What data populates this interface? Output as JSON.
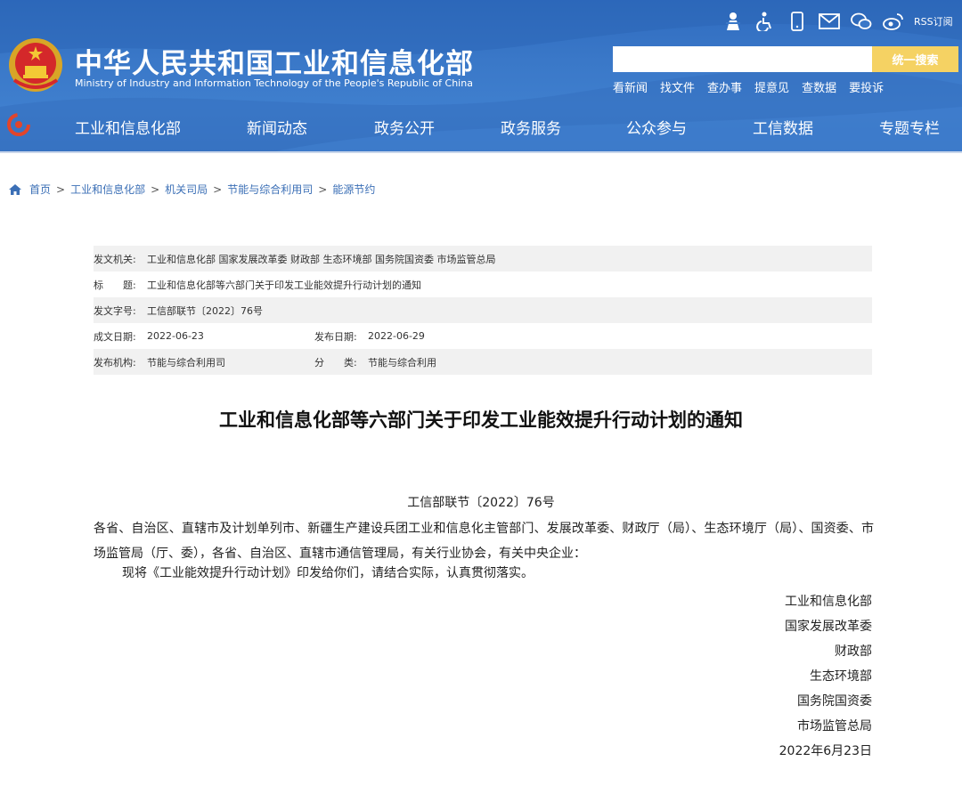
{
  "header": {
    "title_cn": "中华人民共和国工业和信息化部",
    "title_en": "Ministry of Industry and Information Technology of the People's Republic of China",
    "rss_label": "RSS订阅",
    "search_placeholder": "",
    "search_button": "统一搜索",
    "quick_links": [
      "看新闻",
      "找文件",
      "查办事",
      "提意见",
      "查数据",
      "要投诉"
    ],
    "nav": [
      "工业和信息化部",
      "新闻动态",
      "政务公开",
      "政务服务",
      "公众参与",
      "工信数据",
      "专题专栏"
    ],
    "colors": {
      "header_blue": "#3a78c8",
      "search_button": "#f5d263"
    }
  },
  "breadcrumb": {
    "items": [
      "首页",
      "工业和信息化部",
      "机关司局",
      "节能与综合利用司",
      "能源节约"
    ],
    "separator": ">"
  },
  "meta": {
    "issuer_label": "发文机关:",
    "issuer_value": "工业和信息化部 国家发展改革委 财政部 生态环境部 国务院国资委 市场监管总局",
    "title_label": "标　　题:",
    "title_value": "工业和信息化部等六部门关于印发工业能效提升行动计划的通知",
    "docno_label": "发文字号:",
    "docno_value": "工信部联节〔2022〕76号",
    "created_label": "成文日期:",
    "created_value": "2022-06-23",
    "published_label": "发布日期:",
    "published_value": "2022-06-29",
    "agency_label": "发布机构:",
    "agency_value": "节能与综合利用司",
    "category_label": "分　　类:",
    "category_value": "节能与综合利用"
  },
  "article": {
    "title": "工业和信息化部等六部门关于印发工业能效提升行动计划的通知",
    "doc_no": "工信部联节〔2022〕76号",
    "recipients": "各省、自治区、直辖市及计划单列市、新疆生产建设兵团工业和信息化主管部门、发展改革委、财政厅（局）、生态环境厅（局）、国资委、市场监管局（厅、委），各省、自治区、直辖市通信管理局，有关行业协会，有关中央企业：",
    "body": "现将《工业能效提升行动计划》印发给你们，请结合实际，认真贯彻落实。",
    "signers": [
      "工业和信息化部",
      "国家发展改革委",
      "财政部",
      "生态环境部",
      "国务院国资委",
      "市场监管总局"
    ],
    "date": "2022年6月23日"
  }
}
